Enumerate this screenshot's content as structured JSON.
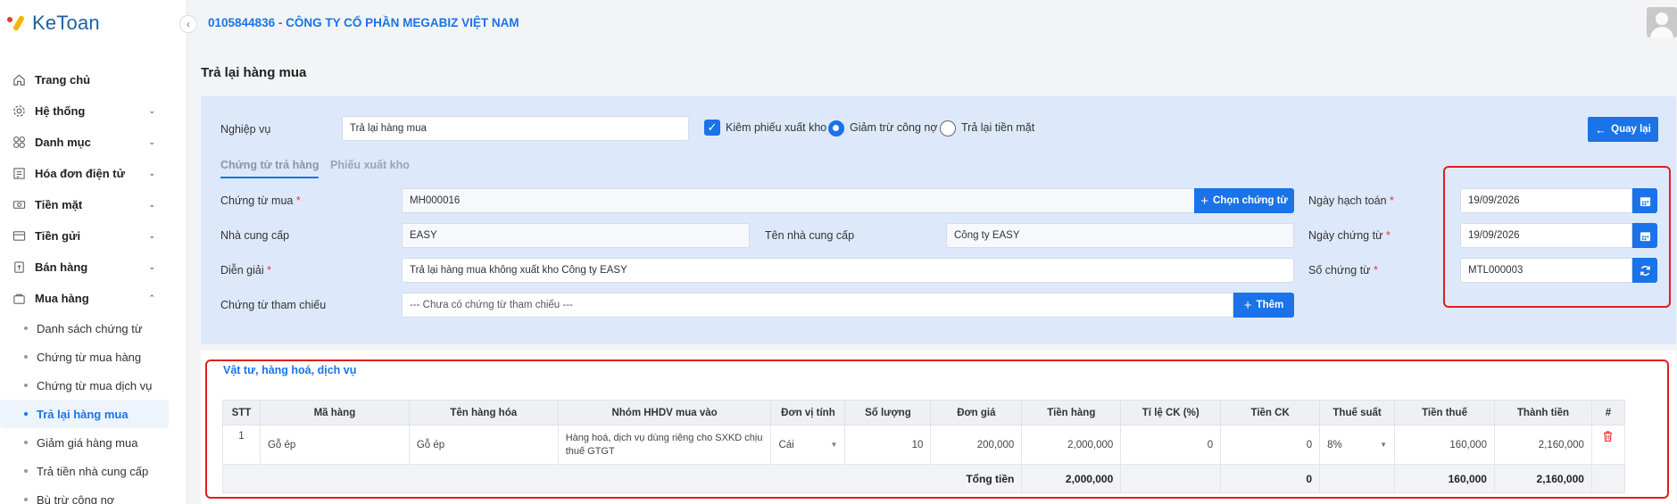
{
  "app": {
    "logo_text": "KeToan"
  },
  "header": {
    "company": "0105844836 - CÔNG TY CỔ PHẦN MEGABIZ VIỆT NAM"
  },
  "sidebar": {
    "items": [
      {
        "label": "Trang chủ",
        "icon": "home-icon",
        "has_children": false
      },
      {
        "label": "Hệ thống",
        "icon": "gear-icon",
        "has_children": true
      },
      {
        "label": "Danh mục",
        "icon": "grid-icon",
        "has_children": true
      },
      {
        "label": "Hóa đơn điện tử",
        "icon": "invoice-icon",
        "has_children": true
      },
      {
        "label": "Tiền mặt",
        "icon": "cash-icon",
        "has_children": true
      },
      {
        "label": "Tiền gửi",
        "icon": "bank-icon",
        "has_children": true
      },
      {
        "label": "Bán hàng",
        "icon": "sales-icon",
        "has_children": true
      },
      {
        "label": "Mua hàng",
        "icon": "purchase-icon",
        "has_children": true,
        "expanded": true
      }
    ],
    "sub_items": [
      {
        "label": "Danh sách chứng từ"
      },
      {
        "label": "Chứng từ mua hàng"
      },
      {
        "label": "Chứng từ mua dịch vụ"
      },
      {
        "label": "Trả lại hàng mua",
        "active": true
      },
      {
        "label": "Giảm giá hàng mua"
      },
      {
        "label": "Trả tiền nhà cung cấp"
      },
      {
        "label": "Bù trừ công nợ"
      }
    ]
  },
  "page": {
    "title": "Trả lại hàng mua"
  },
  "form": {
    "nghiep_vu_label": "Nghiệp vụ",
    "nghiep_vu_value": "Trả lại hàng mua",
    "kiem_phieu_label": "Kiêm phiếu xuất kho",
    "kiem_phieu_checked": true,
    "radio_giam_tru": "Giảm trừ công nợ",
    "radio_tra_lai": "Trả lại tiền mặt",
    "selected_radio": "Giảm trừ công nợ",
    "back_button": "Quay lại",
    "tabs": [
      "Chứng từ trả hàng",
      "Phiếu xuất kho"
    ],
    "chung_tu_mua_label": "Chứng từ mua",
    "chung_tu_mua_value": "MH000016",
    "chon_chung_tu_button": "Chọn chứng từ",
    "nha_cung_cap_label": "Nhà cung cấp",
    "nha_cung_cap_value": "EASY",
    "ten_ncc_label": "Tên nhà cung cấp",
    "ten_ncc_value": "Công ty EASY",
    "dien_giai_label": "Diễn giải",
    "dien_giai_value": "Trả lại hàng mua không xuất kho Công ty EASY",
    "tham_chieu_label": "Chứng từ tham chiếu",
    "tham_chieu_placeholder": "--- Chưa có chứng từ tham chiếu ---",
    "them_button": "Thêm",
    "ngay_hach_toan_label": "Ngày hạch toán",
    "ngay_hach_toan_value": "19/09/2026",
    "ngay_chung_tu_label": "Ngày chứng từ",
    "ngay_chung_tu_value": "19/09/2026",
    "so_chung_tu_label": "Số chứng từ",
    "so_chung_tu_value": "MTL000003",
    "required_mark": "*"
  },
  "items_section": {
    "title": "Vật tư, hàng hoá, dịch vụ",
    "columns": [
      "STT",
      "Mã hàng",
      "Tên hàng hóa",
      "Nhóm HHDV mua vào",
      "Đơn vị tính",
      "Số lượng",
      "Đơn giá",
      "Tiền hàng",
      "Tỉ lệ CK (%)",
      "Tiền CK",
      "Thuế suất",
      "Tiền thuế",
      "Thành tiền",
      "#"
    ],
    "rows": [
      {
        "stt": "1",
        "ma_hang": "Gỗ ép",
        "ten_hang": "Gỗ ép",
        "nhom": "Hàng hoá, dịch vụ dùng riêng cho SXKD chịu thuế GTGT",
        "don_vi": "Cái",
        "so_luong": "10",
        "don_gia": "200,000",
        "tien_hang": "2,000,000",
        "ti_le_ck": "0",
        "tien_ck": "0",
        "thue_suat": "8%",
        "tien_thue": "160,000",
        "thanh_tien": "2,160,000"
      }
    ],
    "totals": {
      "label": "Tổng tiền",
      "tien_hang": "2,000,000",
      "tien_ck": "0",
      "tien_thue": "160,000",
      "thanh_tien": "2,160,000"
    }
  },
  "colors": {
    "accent": "#1a73e8",
    "panel_bg": "#dde9fb",
    "highlight": "#e01e1e"
  }
}
